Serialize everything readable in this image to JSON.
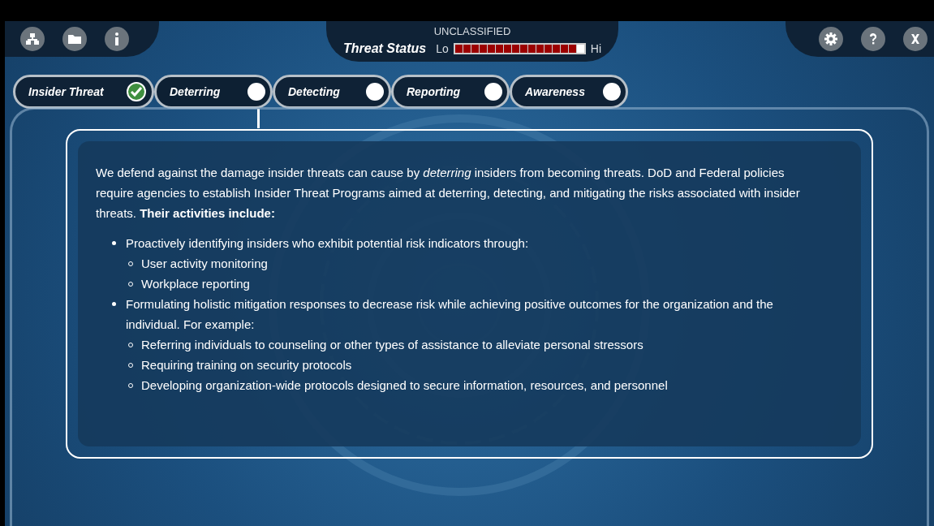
{
  "header": {
    "classification": "UNCLASSIFIED",
    "threat_status": {
      "title": "Threat Status",
      "low_label": "Lo",
      "high_label": "Hi",
      "level": 0.9375
    }
  },
  "tabs": [
    {
      "label": "Insider Threat",
      "completed": true,
      "selected": false
    },
    {
      "label": "Deterring",
      "completed": false,
      "selected": true
    },
    {
      "label": "Detecting",
      "completed": false,
      "selected": false
    },
    {
      "label": "Reporting",
      "completed": false,
      "selected": false
    },
    {
      "label": "Awareness",
      "completed": false,
      "selected": false
    }
  ],
  "content": {
    "intro": "We defend against the damage insider threats can cause by *deterring* insiders from becoming threats. DoD and Federal policies require agencies to establish Insider Threat Programs aimed at deterring, detecting, and mitigating the risks associated with insider threats. **Their activities include:**",
    "bullets": [
      {
        "text": "Proactively identifying insiders who exhibit potential risk indicators through:",
        "children": [
          {
            "text": "User activity monitoring"
          },
          {
            "text": "Workplace reporting"
          }
        ]
      },
      {
        "text": "Formulating holistic mitigation responses to decrease risk while achieving positive outcomes for the organization and the individual. For example:",
        "children": [
          {
            "text": "Referring individuals to counseling or other types of assistance to alleviate personal stressors"
          },
          {
            "text": "Requiring training on security protocols"
          },
          {
            "text": "Developing organization-wide protocols designed to secure information, resources, and personnel"
          }
        ]
      }
    ]
  }
}
